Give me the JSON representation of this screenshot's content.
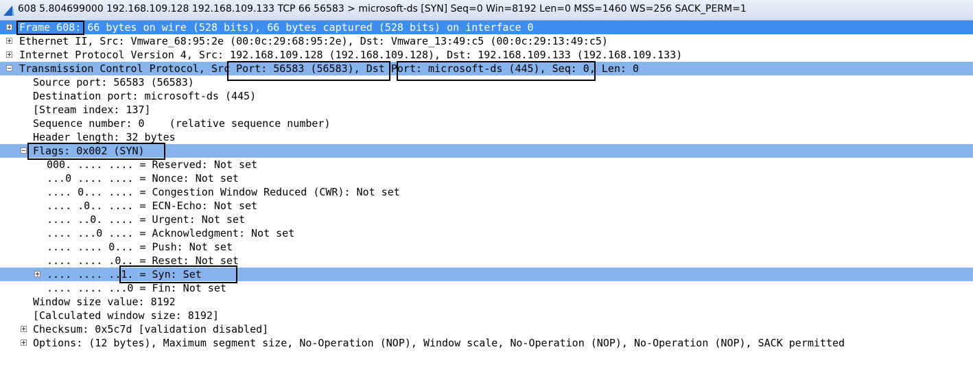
{
  "window": {
    "title": "608 5.804699000 192.168.109.128 192.168.109.133 TCP 66 56583 > microsoft-ds [SYN] Seq=0 Win=8192 Len=0 MSS=1460 WS=256 SACK_PERM=1",
    "icon": "wireshark-fin-icon"
  },
  "tree": {
    "frame": "Frame 608: 66 bytes on wire (528 bits), 66 bytes captured (528 bits) on interface 0",
    "ethernet": "Ethernet II, Src: Vmware_68:95:2e (00:0c:29:68:95:2e), Dst: Vmware_13:49:c5 (00:0c:29:13:49:c5)",
    "ip": "Internet Protocol Version 4, Src: 192.168.109.128 (192.168.109.128), Dst: 192.168.109.133 (192.168.109.133)",
    "tcp": "Transmission Control Protocol, Src Port: 56583 (56583), Dst Port: microsoft-ds (445), Seq: 0, Len: 0",
    "tcp_children": {
      "src_port": "Source port: 56583 (56583)",
      "dst_port": "Destination port: microsoft-ds (445)",
      "stream_index": "[Stream index: 137]",
      "seq": "Sequence number: 0    (relative sequence number)",
      "header_len": "Header length: 32 bytes",
      "flags": "Flags: 0x002 (SYN)",
      "flag_bits": {
        "reserved": "000. .... .... = Reserved: Not set",
        "nonce": "...0 .... .... = Nonce: Not set",
        "cwr": ".... 0... .... = Congestion Window Reduced (CWR): Not set",
        "ecn": ".... .0.. .... = ECN-Echo: Not set",
        "urg": ".... ..0. .... = Urgent: Not set",
        "ack": ".... ...0 .... = Acknowledgment: Not set",
        "push": ".... .... 0... = Push: Not set",
        "reset": ".... .... .0.. = Reset: Not set",
        "syn": ".... .... ..1. = Syn: Set",
        "fin": ".... .... ...0 = Fin: Not set"
      },
      "window_size": "Window size value: 8192",
      "calc_window": "[Calculated window size: 8192]",
      "checksum": "Checksum: 0x5c7d [validation disabled]",
      "options": "Options: (12 bytes), Maximum segment size, No-Operation (NOP), Window scale, No-Operation (NOP), No-Operation (NOP), SACK permitted"
    }
  },
  "colors": {
    "selected_row": "#3d8ef0",
    "highlight_row": "#88b4ee",
    "annotation_box": "#000000"
  }
}
